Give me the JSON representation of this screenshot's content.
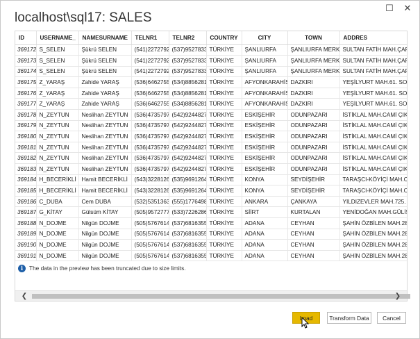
{
  "window": {
    "title": "localhost\\sql17: SALES",
    "minimize_glyph": "☐",
    "close_glyph": "✕"
  },
  "table": {
    "columns": [
      "ID",
      "USERNAME_",
      "NAMESURNAME",
      "TELNR1",
      "TELNR2",
      "COUNTRY",
      "CITY",
      "TOWN",
      "ADDRES"
    ],
    "rows": [
      [
        "369172",
        "S_SELEN",
        "Şükrü SELEN",
        "(541)2272792",
        "(537)9527833",
        "TÜRKİYE",
        "ŞANLIURFA",
        "ŞANLIURFA MERKEZ",
        "SULTAN FATİH MAH.ÇARŞI C"
      ],
      [
        "369173",
        "S_SELEN",
        "Şükrü SELEN",
        "(541)2272792",
        "(537)9527833",
        "TÜRKİYE",
        "ŞANLIURFA",
        "ŞANLIURFA MERKEZ",
        "SULTAN FATİH MAH.ÇARŞI C"
      ],
      [
        "369174",
        "S_SELEN",
        "Şükrü SELEN",
        "(541)2272792",
        "(537)9527833",
        "TÜRKİYE",
        "ŞANLIURFA",
        "ŞANLIURFA MERKEZ",
        "SULTAN FATİH MAH.ÇARŞI C"
      ],
      [
        "369175",
        "Z_YARAŞ",
        "Zahide YARAŞ",
        "(536)6462755",
        "(534)8856281",
        "TÜRKİYE",
        "AFYONKARAHİSAR",
        "DAZKIRI",
        "YEŞİLYURT MAH.61. SOKAK"
      ],
      [
        "369176",
        "Z_YARAŞ",
        "Zahide YARAŞ",
        "(536)6462755",
        "(534)8856281",
        "TÜRKİYE",
        "AFYONKARAHİSAR",
        "DAZKIRI",
        "YEŞİLYURT MAH.61. SOKAK"
      ],
      [
        "369177",
        "Z_YARAŞ",
        "Zahide YARAŞ",
        "(536)6462755",
        "(534)8856281",
        "TÜRKİYE",
        "AFYONKARAHİSAR",
        "DAZKIRI",
        "YEŞİLYURT MAH.61. SOKAK"
      ],
      [
        "369178",
        "N_ZEYTUN",
        "Neslihan ZEYTUN",
        "(536)4735797",
        "(542)9244827",
        "TÜRKİYE",
        "ESKİŞEHİR",
        "ODUNPAZARI",
        "İSTİKLAL MAH.CAMİ ÇIKMAZ"
      ],
      [
        "369179",
        "N_ZEYTUN",
        "Neslihan ZEYTUN",
        "(536)4735797",
        "(542)9244827",
        "TÜRKİYE",
        "ESKİŞEHİR",
        "ODUNPAZARI",
        "İSTİKLAL MAH.CAMİ ÇIKMAZ"
      ],
      [
        "369180",
        "N_ZEYTUN",
        "Neslihan ZEYTUN",
        "(536)4735797",
        "(542)9244827",
        "TÜRKİYE",
        "ESKİŞEHİR",
        "ODUNPAZARI",
        "İSTİKLAL MAH.CAMİ ÇIKMAZ"
      ],
      [
        "369181",
        "N_ZEYTUN",
        "Neslihan ZEYTUN",
        "(536)4735797",
        "(542)9244827",
        "TÜRKİYE",
        "ESKİŞEHİR",
        "ODUNPAZARI",
        "İSTİKLAL MAH.CAMİ ÇIKMAZ"
      ],
      [
        "369182",
        "N_ZEYTUN",
        "Neslihan ZEYTUN",
        "(536)4735797",
        "(542)9244827",
        "TÜRKİYE",
        "ESKİŞEHİR",
        "ODUNPAZARI",
        "İSTİKLAL MAH.CAMİ ÇIKMAZ"
      ],
      [
        "369183",
        "N_ZEYTUN",
        "Neslihan ZEYTUN",
        "(536)4735797",
        "(542)9244827",
        "TÜRKİYE",
        "ESKİŞEHİR",
        "ODUNPAZARI",
        "İSTİKLAL MAH.CAMİ ÇIKMAZ"
      ],
      [
        "369184",
        "H_BECERİKLİ",
        "Hamit BECERİKLİ",
        "(543)3228126",
        "(535)9691264",
        "TÜRKİYE",
        "KONYA",
        "SEYDİŞEHİR",
        "TARAŞCI-KÖYİÇİ MAH.CUMH"
      ],
      [
        "369185",
        "H_BECERİKLİ",
        "Hamit BECERİKLİ",
        "(543)3228126",
        "(535)9691264",
        "TÜRKİYE",
        "KONYA",
        "SEYDİŞEHİR",
        "TARAŞCI-KÖYİÇİ MAH.CUMH"
      ],
      [
        "369186",
        "C_DUBA",
        "Cem DUBA",
        "(532)5351363",
        "(555)1776498",
        "TÜRKİYE",
        "ANKARA",
        "ÇANKAYA",
        "YILDIZEVLER MAH.725. SOKA"
      ],
      [
        "369187",
        "G_KİTAY",
        "Gülsüm KİTAY",
        "(505)9572777",
        "(533)7226286",
        "TÜRKİYE",
        "SİİRT",
        "KURTALAN",
        "YENİDOĞAN MAH.GÜLİSTAN"
      ],
      [
        "369188",
        "N_DOJME",
        "Nilgün DOJME",
        "(505)5767614",
        "(537)6816355",
        "TÜRKİYE",
        "ADANA",
        "CEYHAN",
        "ŞAHİN ÖZBİLEN MAH.280. S"
      ],
      [
        "369189",
        "N_DOJME",
        "Nilgün DOJME",
        "(505)5767614",
        "(537)6816355",
        "TÜRKİYE",
        "ADANA",
        "CEYHAN",
        "ŞAHİN ÖZBİLEN MAH.280. S"
      ],
      [
        "369190",
        "N_DOJME",
        "Nilgün DOJME",
        "(505)5767614",
        "(537)6816355",
        "TÜRKİYE",
        "ADANA",
        "CEYHAN",
        "ŞAHİN ÖZBİLEN MAH.280. S"
      ],
      [
        "369191",
        "N_DOJME",
        "Nilgün DOJME",
        "(505)5767614",
        "(537)6816355",
        "TÜRKİYE",
        "ADANA",
        "CEYHAN",
        "ŞAHİN ÖZBİLEN MAH.280. S"
      ]
    ]
  },
  "info": {
    "icon": "info-icon",
    "icon_glyph": "i",
    "message": "The data in the preview has been truncated due to size limits."
  },
  "scrollbar": {
    "left_glyph": "❮",
    "right_glyph": "❯"
  },
  "buttons": {
    "load": "Load",
    "transform": "Transform Data",
    "cancel": "Cancel"
  },
  "colors": {
    "load_button": "#e6b800",
    "info_icon": "#1e5fa8"
  }
}
